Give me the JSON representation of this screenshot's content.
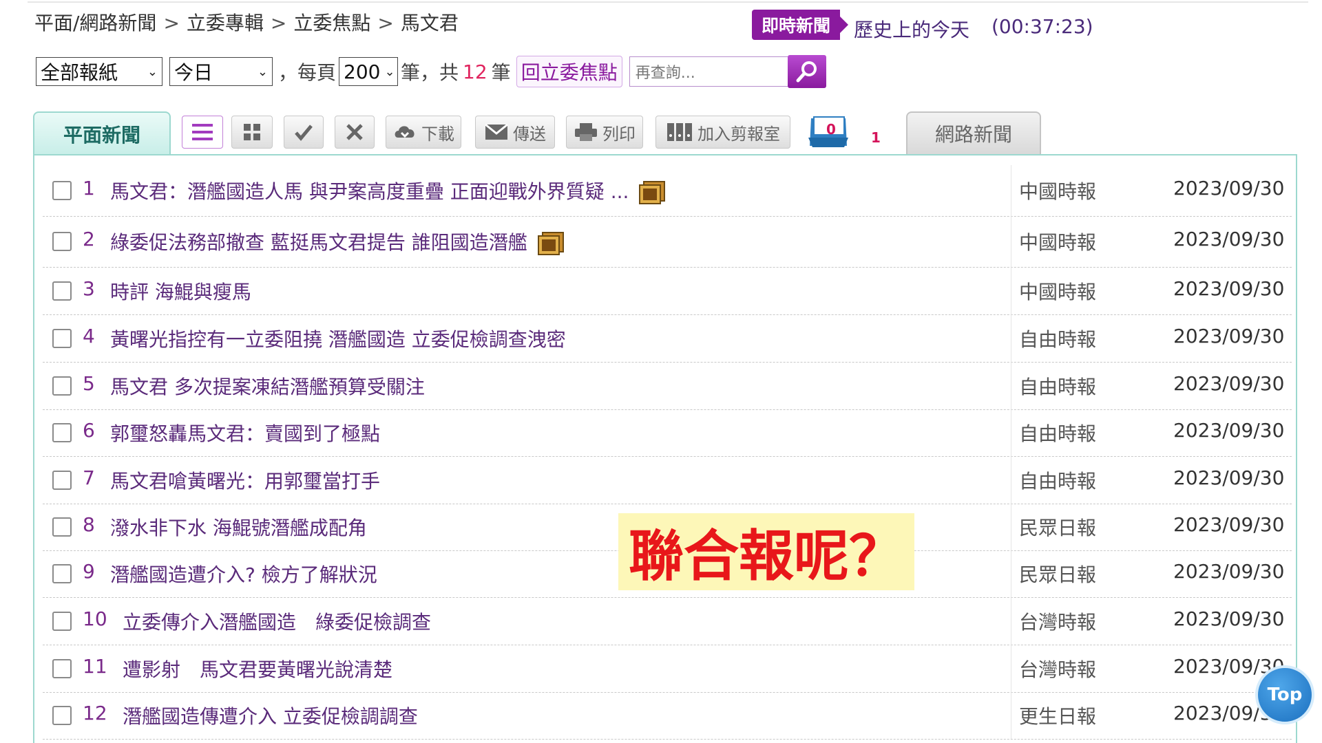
{
  "breadcrumb": {
    "items": [
      "平面/網路新聞",
      "立委專輯",
      "立委焦點",
      "馬文君"
    ],
    "separator": ">"
  },
  "header": {
    "realtime_label": "即時新聞",
    "history_label": "歷史上的今天",
    "clock": "(00:37:23)"
  },
  "filters": {
    "paper_select": "全部報紙",
    "day_select": "今日",
    "per_page_prefix": "，每頁",
    "per_page_value": "200",
    "per_page_unit": "筆，共",
    "total_count": "12",
    "total_unit": "筆",
    "back_button": "回立委焦點",
    "search_placeholder": "再查詢..."
  },
  "tabs": {
    "print_news": "平面新聞",
    "web_news": "網路新聞"
  },
  "toolbar": {
    "download": "下載",
    "send": "傳送",
    "print": "列印",
    "clip": "加入剪報室",
    "cart_count": "0",
    "cart_badge": "1"
  },
  "news": [
    {
      "no": "1",
      "title": "馬文君：潛艦國造人馬 與尹案高度重疊 正面迎戰外界質疑 ...",
      "paper": "中國時報",
      "date": "2023/09/30",
      "photo": true
    },
    {
      "no": "2",
      "title": "綠委促法務部撤查 藍挺馬文君提告 誰阻國造潛艦",
      "paper": "中國時報",
      "date": "2023/09/30",
      "photo": true
    },
    {
      "no": "3",
      "title": "時評 海鯤與瘦馬",
      "paper": "中國時報",
      "date": "2023/09/30",
      "photo": false
    },
    {
      "no": "4",
      "title": "黃曙光指控有一立委阻撓 潛艦國造 立委促檢調查洩密",
      "paper": "自由時報",
      "date": "2023/09/30",
      "photo": false
    },
    {
      "no": "5",
      "title": "馬文君 多次提案凍結潛艦預算受關注",
      "paper": "自由時報",
      "date": "2023/09/30",
      "photo": false
    },
    {
      "no": "6",
      "title": "郭璽怒轟馬文君：賣國到了極點",
      "paper": "自由時報",
      "date": "2023/09/30",
      "photo": false
    },
    {
      "no": "7",
      "title": "馬文君嗆黃曙光：用郭璽當打手",
      "paper": "自由時報",
      "date": "2023/09/30",
      "photo": false
    },
    {
      "no": "8",
      "title": "潑水非下水 海鯤號潛艦成配角",
      "paper": "民眾日報",
      "date": "2023/09/30",
      "photo": false
    },
    {
      "no": "9",
      "title": "潛艦國造遭介入? 檢方了解狀況",
      "paper": "民眾日報",
      "date": "2023/09/30",
      "photo": false
    },
    {
      "no": "10",
      "title": "立委傳介入潛艦國造　綠委促檢調查",
      "paper": "台灣時報",
      "date": "2023/09/30",
      "photo": false
    },
    {
      "no": "11",
      "title": "遭影射　馬文君要黃曙光說清楚",
      "paper": "台灣時報",
      "date": "2023/09/30",
      "photo": false
    },
    {
      "no": "12",
      "title": "潛艦國造傳遭介入 立委促檢調調查",
      "paper": "更生日報",
      "date": "2023/09/30",
      "photo": false
    }
  ],
  "overlay_text": "聯合報呢？",
  "top_button": "Top",
  "colors": {
    "brand_purple": "#8a1a9e",
    "accent_pink": "#e0245e",
    "tab_teal": "#9cd8cf",
    "overlay_red": "#e8171a",
    "overlay_bg": "#fdf7b8"
  }
}
